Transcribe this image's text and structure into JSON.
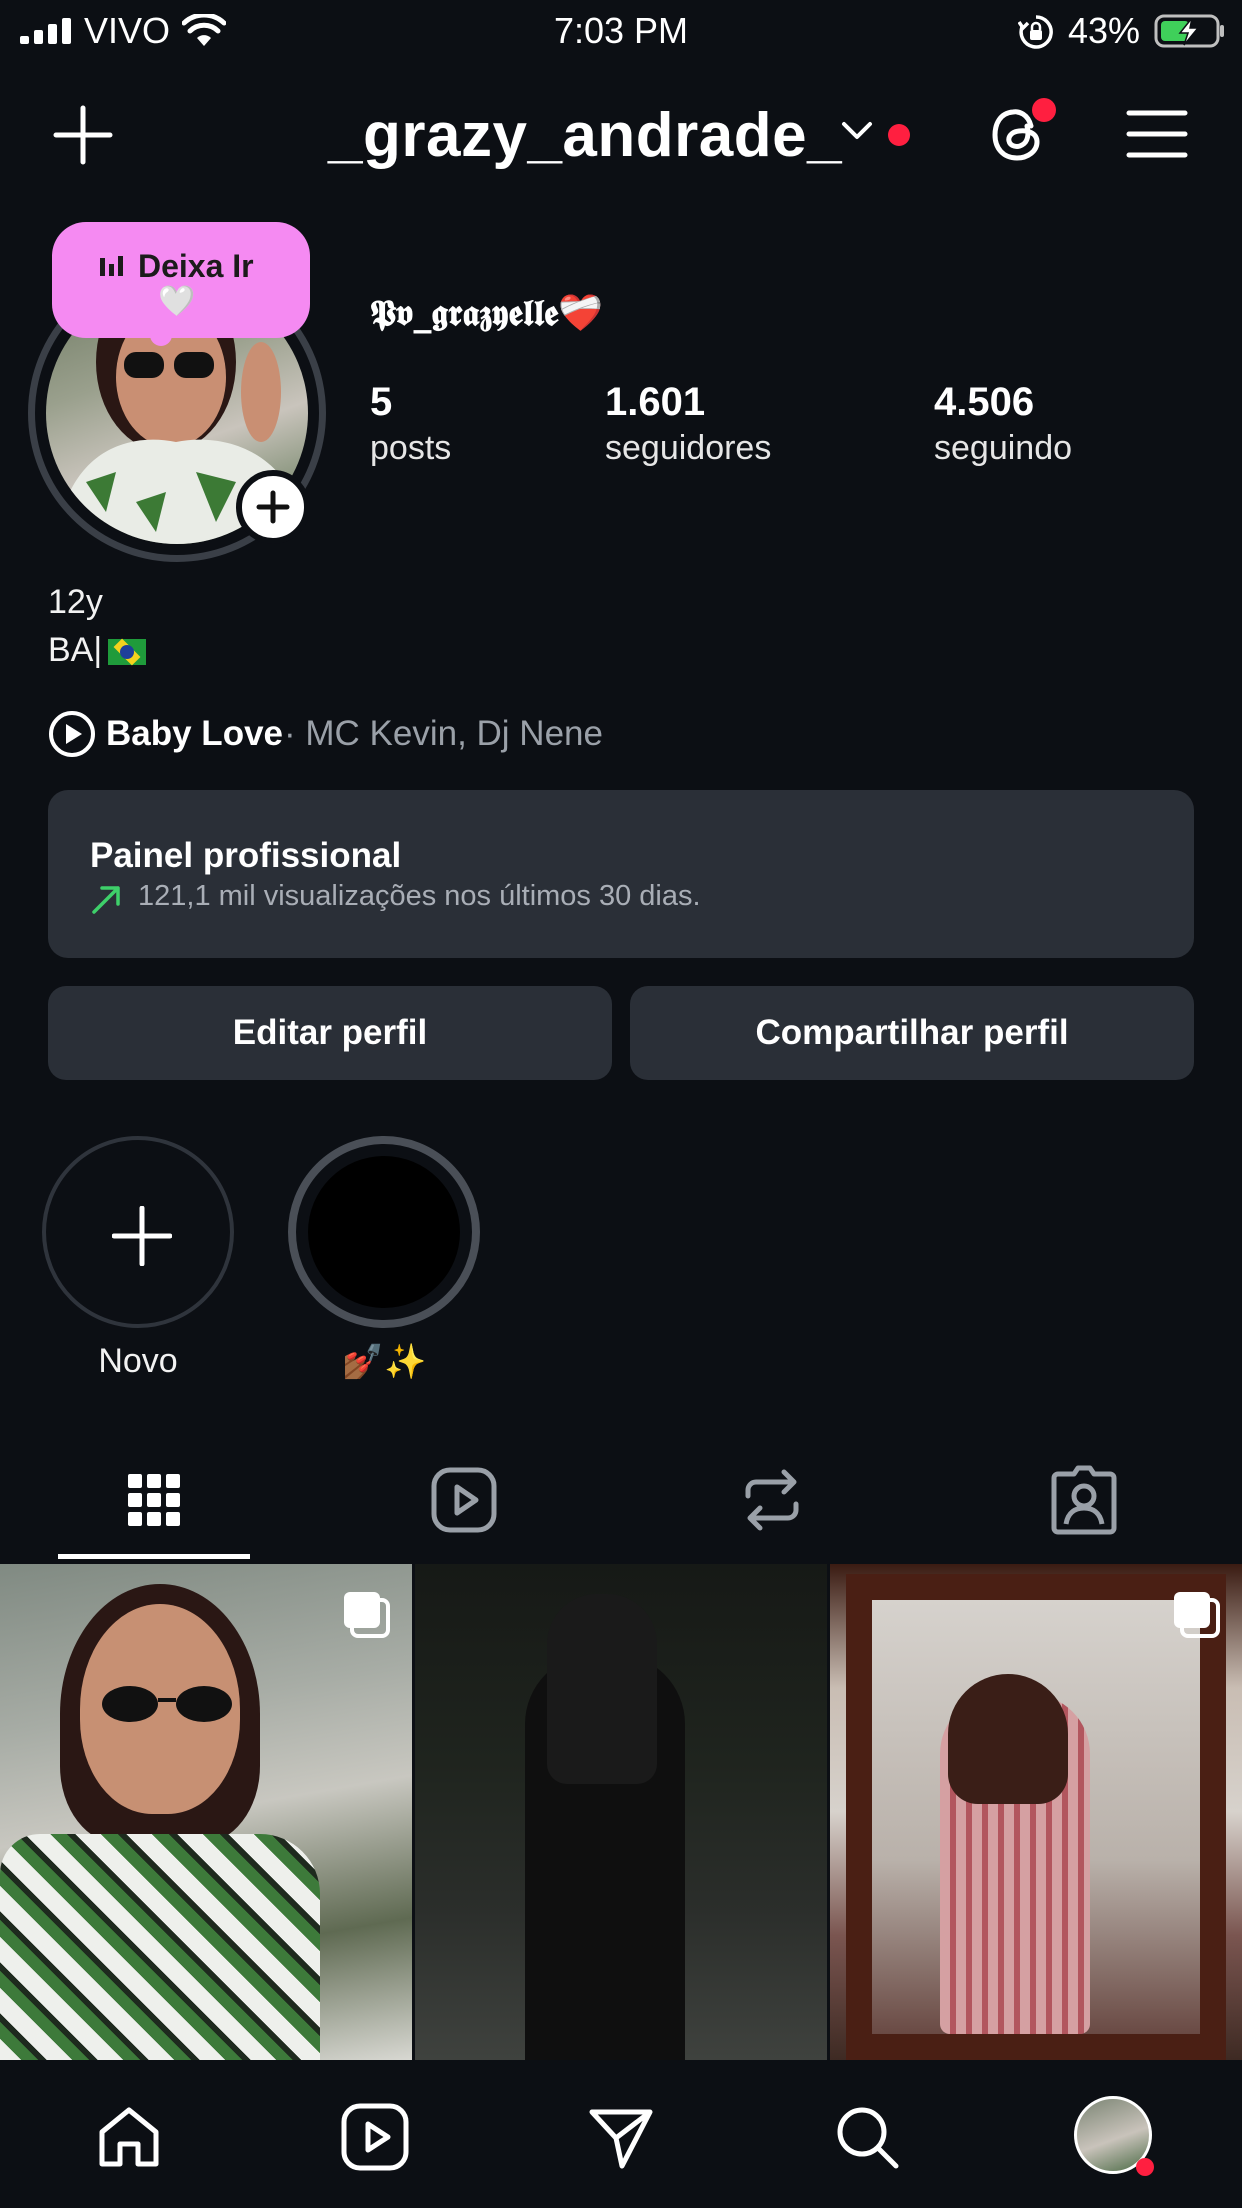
{
  "status_bar": {
    "carrier": "VIVO",
    "time": "7:03 PM",
    "battery_percent": "43%",
    "icons": [
      "signal-icon",
      "wifi-icon",
      "orientation-lock-icon",
      "battery-charging-icon"
    ]
  },
  "header": {
    "username": "_grazy_andrade_",
    "icons": [
      "plus-icon",
      "chevron-down-icon",
      "threads-icon",
      "menu-icon"
    ],
    "notification_color": "#ff1f40"
  },
  "profile": {
    "note": "Deixa Ir",
    "note_emoji": "🤍",
    "display_name": "𝕻𝖛_𝖌𝖗𝖆𝖟𝖞𝖊𝖑𝖑𝖊❤️‍🩹",
    "stats": [
      {
        "value": "5",
        "label": "posts"
      },
      {
        "value": "1.601",
        "label": "seguidores"
      },
      {
        "value": "4.506",
        "label": "seguindo"
      }
    ],
    "bio_line1": "12y",
    "bio_line2": "BA|",
    "music_title": "Baby Love",
    "music_artists": "· MC Kevin, Dj Nene"
  },
  "dashboard": {
    "title": "Painel profissional",
    "subtitle": "121,1 mil visualizações nos últimos 30 dias.",
    "trend_color": "#3ed06a"
  },
  "actions": {
    "edit": "Editar perfil",
    "share": "Compartilhar perfil"
  },
  "highlights": [
    {
      "label": "Novo"
    },
    {
      "label": "💅🏾✨"
    }
  ],
  "tabs": [
    "grid-icon",
    "reels-icon",
    "reposts-icon",
    "tagged-icon"
  ],
  "bottom_nav": [
    "home-icon",
    "reels-icon",
    "direct-icon",
    "search-icon",
    "profile-avatar"
  ],
  "accent": {
    "note_bg": "#f58af2",
    "bg": "#0c0f14",
    "surface": "#2a2f37"
  }
}
